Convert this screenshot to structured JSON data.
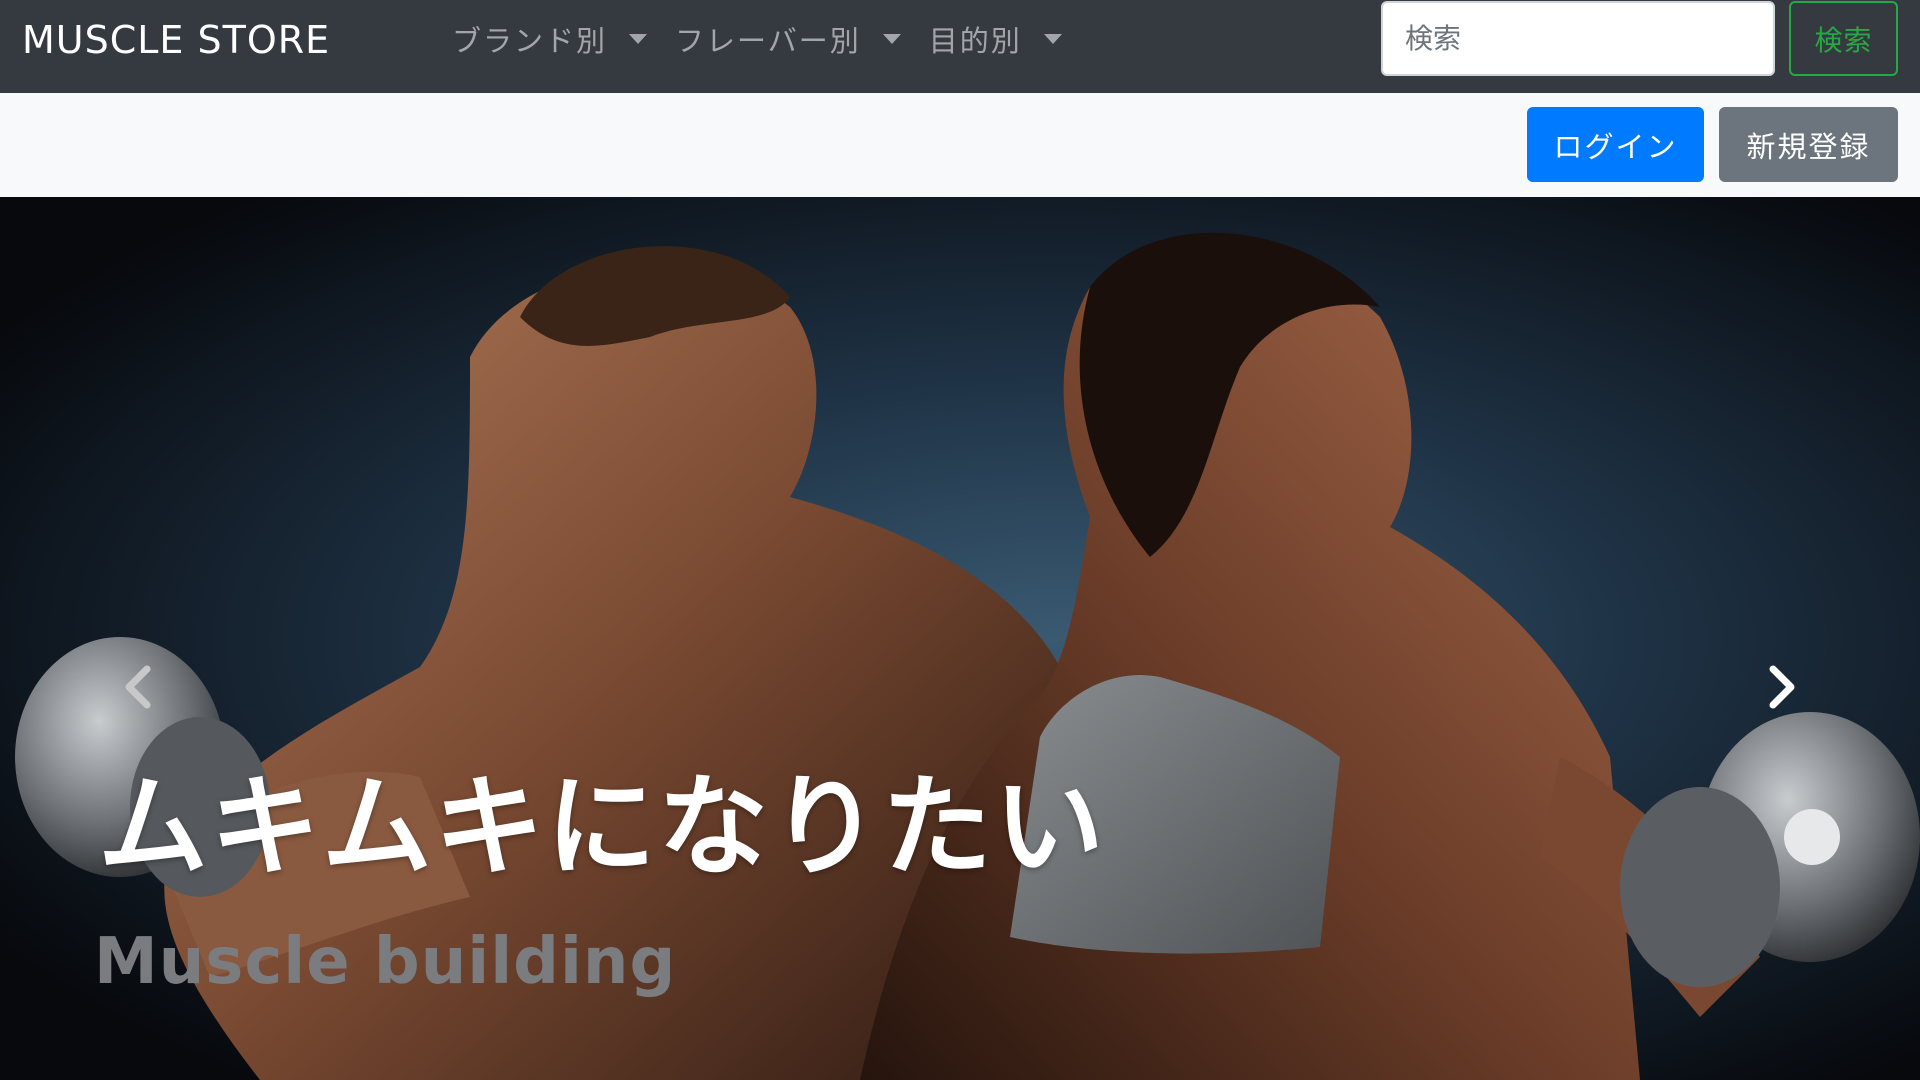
{
  "navbar": {
    "brand": "MUSCLE STORE",
    "menu": [
      {
        "label": "ブランド別"
      },
      {
        "label": "フレーバー別"
      },
      {
        "label": "目的別"
      }
    ],
    "search": {
      "placeholder": "検索",
      "button_label": "検索"
    }
  },
  "auth": {
    "login_label": "ログイン",
    "signup_label": "新規登録"
  },
  "carousel": {
    "caption_title": "ムキムキになりたい",
    "caption_subtitle": "Muscle building",
    "prev_icon": "chevron-left-icon",
    "next_icon": "chevron-right-icon"
  },
  "colors": {
    "navbar_bg": "#343a40",
    "subbar_bg": "#f8f9fa",
    "login_button": "#007bff",
    "signup_button": "#6c757d",
    "search_button": "#28a745"
  }
}
